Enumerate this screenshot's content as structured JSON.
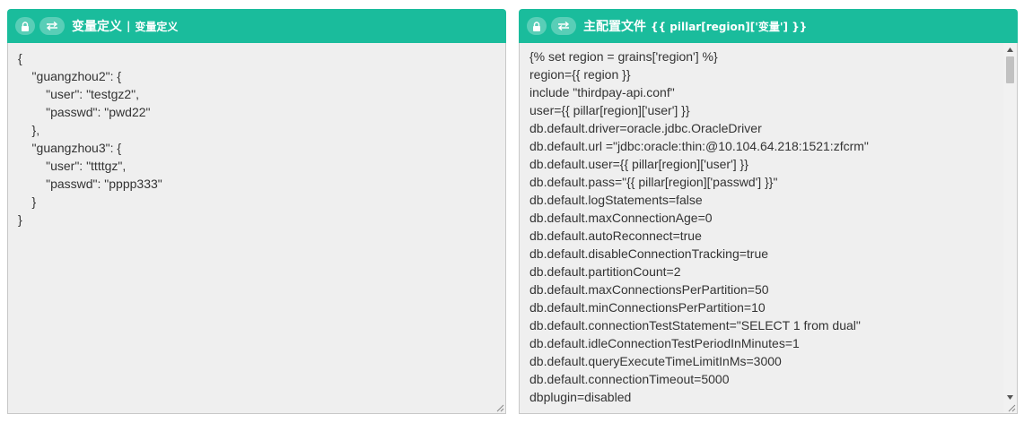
{
  "left_panel": {
    "title": "变量定义",
    "separator": "|",
    "subtitle": "变量定义",
    "icons": [
      "lock-icon",
      "swap-icon"
    ],
    "content": "{\n    \"guangzhou2\": {\n        \"user\": \"testgz2\",\n        \"passwd\": \"pwd22\"\n    },\n    \"guangzhou3\": {\n        \"user\": \"ttttgz\",\n        \"passwd\": \"pppp333\"\n    }\n}"
  },
  "right_panel": {
    "title": "主配置文件",
    "subtitle": "{{ pillar[region]['变量'] }}",
    "icons": [
      "lock-icon",
      "swap-icon"
    ],
    "content": "{% set region = grains['region'] %}\nregion={{ region }}\ninclude \"thirdpay-api.conf\"\nuser={{ pillar[region]['user'] }}\ndb.default.driver=oracle.jdbc.OracleDriver\ndb.default.url =\"jdbc:oracle:thin:@10.104.64.218:1521:zfcrm\"\ndb.default.user={{ pillar[region]['user'] }}\ndb.default.pass=\"{{ pillar[region]['passwd'] }}\"\ndb.default.logStatements=false\ndb.default.maxConnectionAge=0\ndb.default.autoReconnect=true\ndb.default.disableConnectionTracking=true\ndb.default.partitionCount=2\ndb.default.maxConnectionsPerPartition=50\ndb.default.minConnectionsPerPartition=10\ndb.default.connectionTestStatement=\"SELECT 1 from dual\"\ndb.default.idleConnectionTestPeriodInMinutes=1\ndb.default.queryExecuteTimeLimitInMs=3000\ndb.default.connectionTimeout=5000\ndbplugin=disabled"
  },
  "colors": {
    "header": "#1abc9c",
    "editor_bg": "#efefef",
    "text": "#333333"
  }
}
